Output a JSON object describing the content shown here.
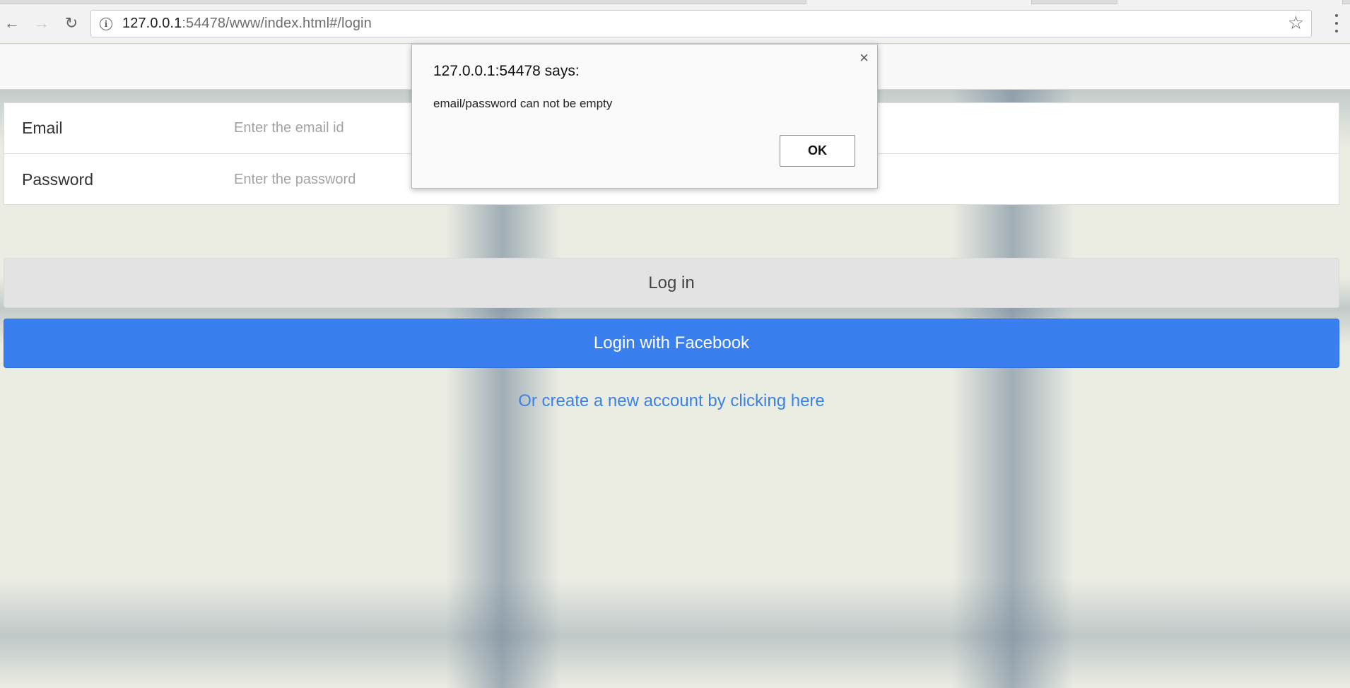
{
  "browser": {
    "url_host": "127.0.0.1",
    "url_rest": ":54478/www/index.html#/login"
  },
  "form": {
    "email_label": "Email",
    "email_placeholder": "Enter the email id",
    "email_value": "",
    "password_label": "Password",
    "password_placeholder": "Enter the password",
    "password_value": ""
  },
  "buttons": {
    "login_label": "Log in",
    "facebook_label": "Login with Facebook"
  },
  "links": {
    "create_account": "Or create a new account by clicking here"
  },
  "alert": {
    "title": "127.0.0.1:54478 says:",
    "message": "email/password can not be empty",
    "ok_label": "OK",
    "close_glyph": "×"
  },
  "colors": {
    "facebook_button": "#3a7ff0",
    "link": "#3b82e8",
    "login_button": "#e3e3e3"
  }
}
